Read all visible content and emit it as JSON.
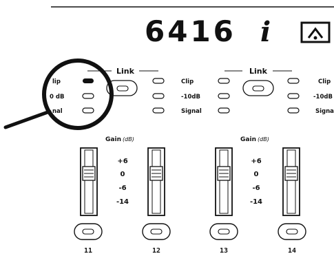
{
  "model": {
    "number": "6416",
    "suffix": "i"
  },
  "logo_icon": "home-arrow-icon",
  "colors": {
    "ink": "#111111",
    "paper": "#ffffff"
  },
  "link_label": "Link",
  "indicator_labels": {
    "clip": "Clip",
    "minus10": "-10dB",
    "signal": "Signal"
  },
  "zoom_labels": {
    "clip": "lip",
    "zero": "0 dB",
    "signal": "nal"
  },
  "gain": {
    "title": "Gain",
    "unit": "(dB)",
    "ticks": [
      "+6",
      "0",
      "-6",
      "-14"
    ]
  },
  "channels": [
    "11",
    "12",
    "13",
    "14"
  ]
}
